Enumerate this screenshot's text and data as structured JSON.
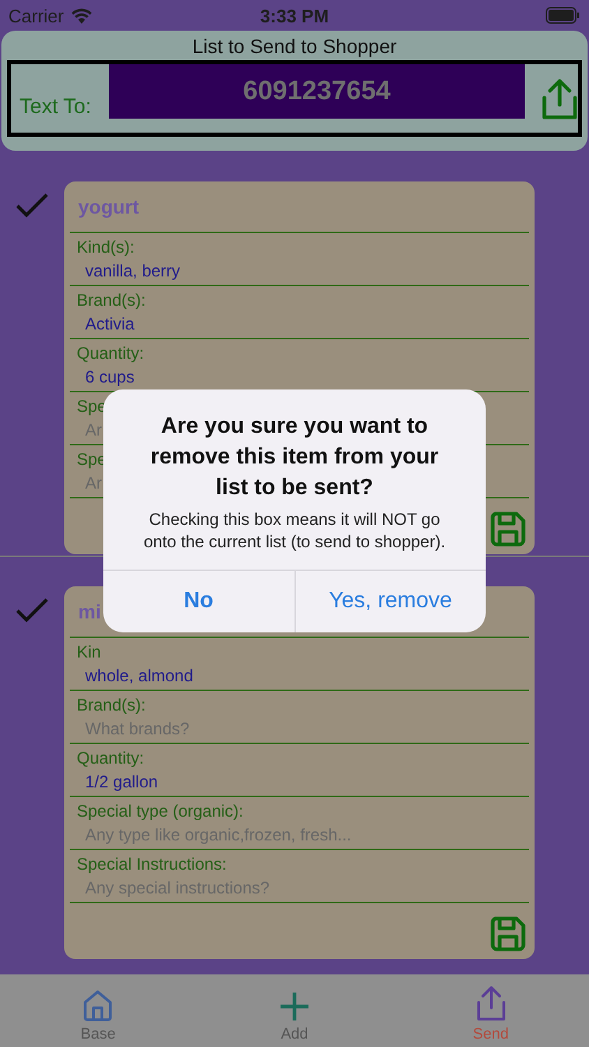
{
  "status_bar": {
    "carrier": "Carrier",
    "time": "3:33 PM"
  },
  "header": {
    "title": "List to Send to Shopper",
    "label": "Text To:",
    "phone": "6091237654"
  },
  "items": [
    {
      "checked": true,
      "title": "yogurt",
      "fields": [
        {
          "label": "Kind(s):",
          "value": "vanilla, berry"
        },
        {
          "label": "Brand(s):",
          "value": "Activia"
        },
        {
          "label": "Quantity:",
          "value": "6 cups"
        },
        {
          "label": "Spe",
          "placeholder": "Ar"
        },
        {
          "label": "Spe",
          "placeholder": "Ar"
        }
      ]
    },
    {
      "checked": true,
      "title": "mi",
      "fields": [
        {
          "label": "Kin",
          "value": "whole, almond"
        },
        {
          "label": "Brand(s):",
          "placeholder": "What brands?"
        },
        {
          "label": "Quantity:",
          "value": "1/2 gallon"
        },
        {
          "label": "Special type (organic):",
          "placeholder": "Any type like organic,frozen, fresh..."
        },
        {
          "label": "Special Instructions:",
          "placeholder": "Any special instructions?"
        }
      ]
    }
  ],
  "alert": {
    "title": "Are you sure you want to remove this item from your list to be sent?",
    "message": "Checking this box means it will NOT go onto the current list (to send to shopper).",
    "buttons": [
      {
        "label": "No",
        "kind": "cancel"
      },
      {
        "label": "Yes, remove",
        "kind": "default"
      }
    ]
  },
  "tabs": [
    {
      "label": "Base",
      "kind": "home",
      "selected": false
    },
    {
      "label": "Add",
      "kind": "add",
      "selected": false
    },
    {
      "label": "Send",
      "kind": "send",
      "selected": true
    }
  ]
}
